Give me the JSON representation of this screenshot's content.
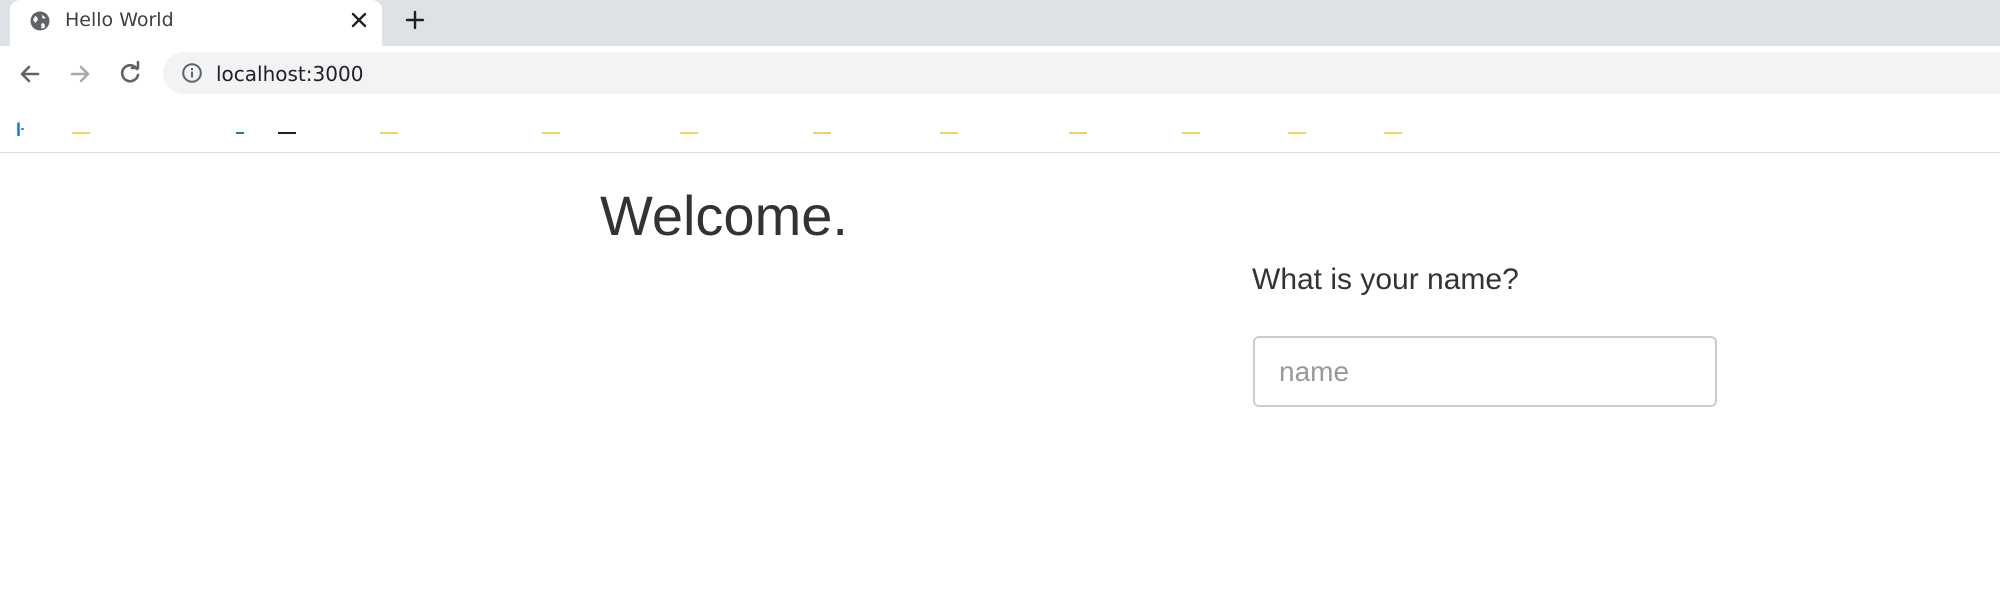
{
  "browser": {
    "tab": {
      "title": "Hello World"
    },
    "address_bar": {
      "url": "localhost:3000"
    }
  },
  "page": {
    "heading": "Welcome.",
    "form": {
      "question": "What is your name?",
      "name_input": {
        "value": "",
        "placeholder": "name"
      }
    }
  },
  "colors": {
    "tabstrip_bg": "#dee1e6",
    "omnibox_bg": "#f1f3f4",
    "text_primary": "#333333"
  }
}
